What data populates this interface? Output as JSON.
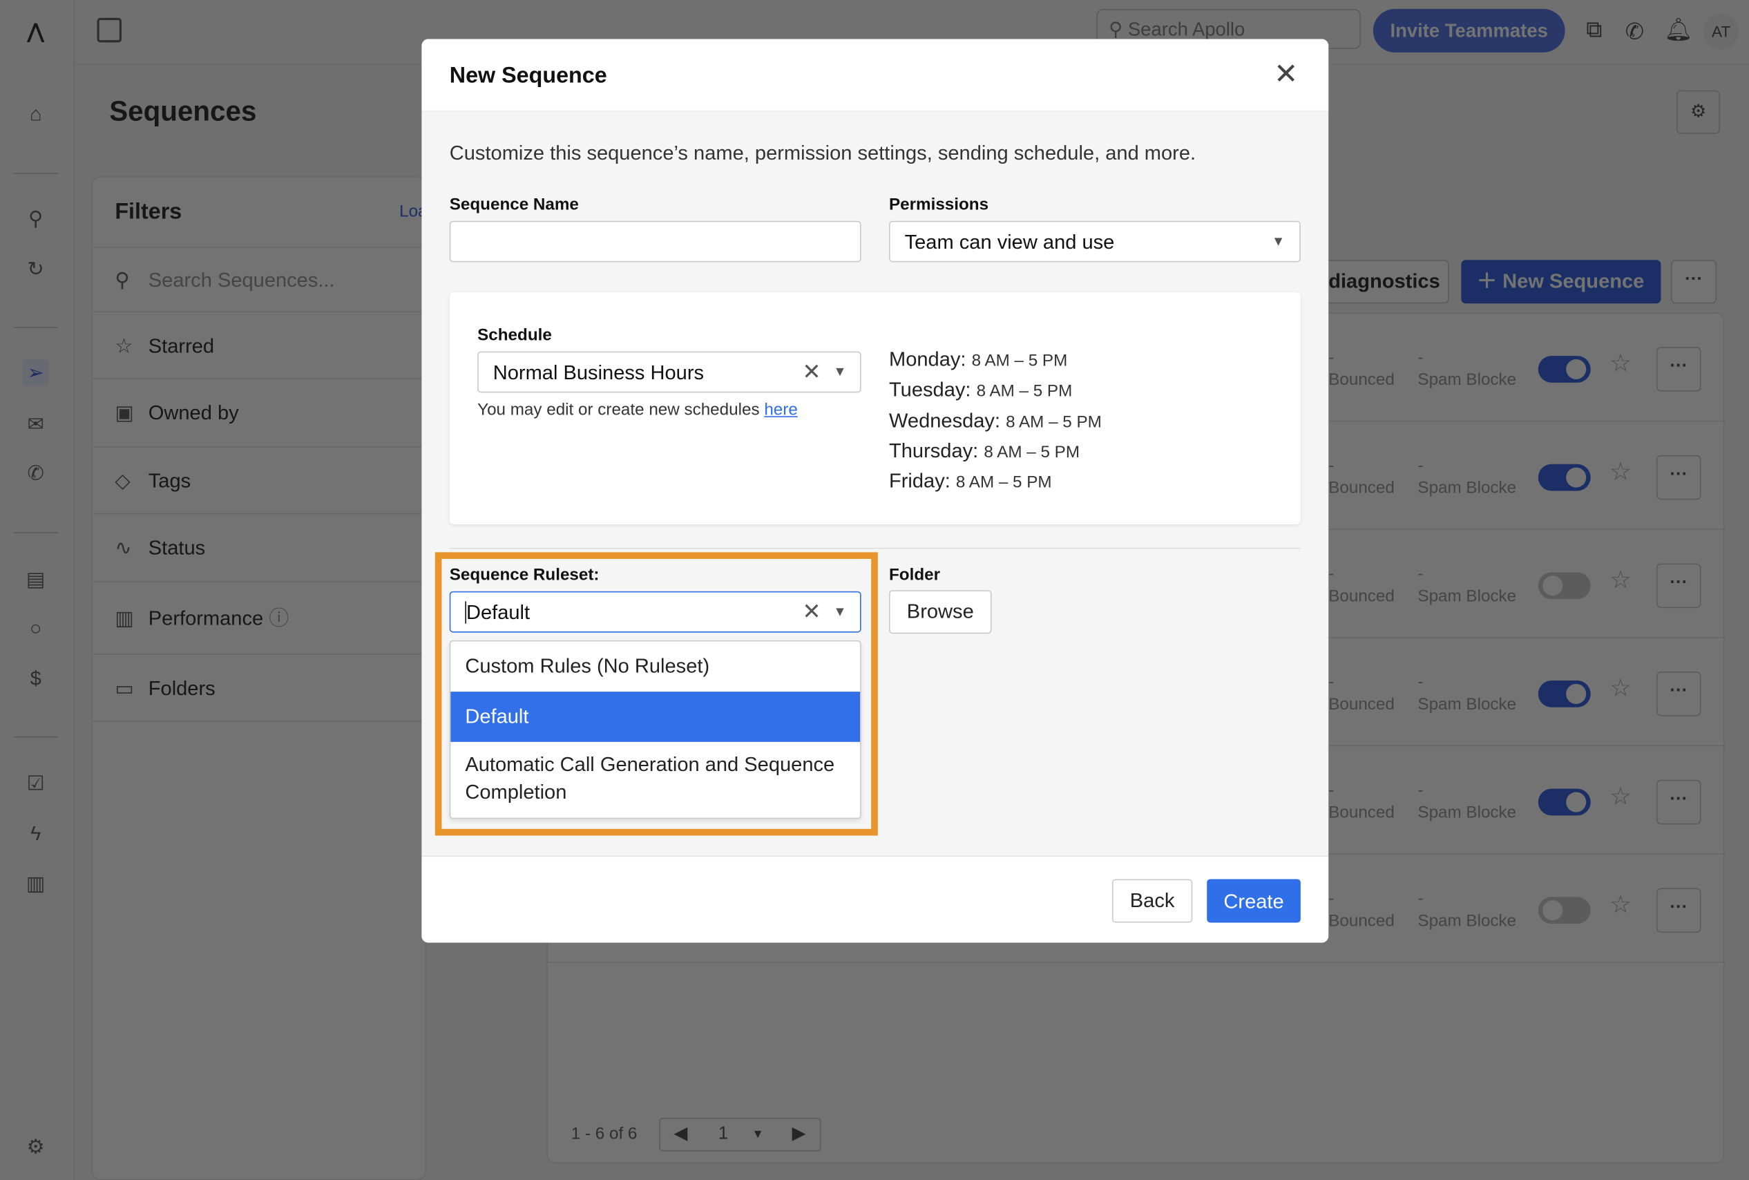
{
  "topbar": {
    "search_placeholder": "Search Apollo",
    "invite_label": "Invite Teammates",
    "avatar": "AT"
  },
  "page": {
    "title": "Sequences"
  },
  "filters": {
    "title": "Filters",
    "load_link": "Loa",
    "search_placeholder": "Search Sequences...",
    "items": [
      "Starred",
      "Owned by",
      "Tags",
      "Status",
      "Performance",
      "Folders"
    ]
  },
  "toolbar": {
    "diagnostics": "diagnostics",
    "new_sequence": "New Sequence"
  },
  "rows": [
    {
      "bounced": "Bounced",
      "spam": "Spam Blocke",
      "dash": "-",
      "enabled": true
    },
    {
      "bounced": "Bounced",
      "spam": "Spam Blocke",
      "dash": "-",
      "enabled": true
    },
    {
      "bounced": "Bounced",
      "spam": "Spam Blocke",
      "dash": "-",
      "enabled": false
    },
    {
      "bounced": "Bounced",
      "spam": "Spam Blocke",
      "dash": "-",
      "enabled": true
    },
    {
      "bounced": "Bounced",
      "spam": "Spam Blocke",
      "dash": "-",
      "enabled": true
    },
    {
      "bounced": "Bounced",
      "spam": "Spam Blocke",
      "dash": "-",
      "enabled": false
    }
  ],
  "pagination": {
    "range": "1 - 6 of 6",
    "page": "1"
  },
  "modal": {
    "title": "New Sequence",
    "description": "Customize this sequence’s name, permission settings, sending schedule, and more.",
    "name_label": "Sequence Name",
    "name_value": "",
    "permissions_label": "Permissions",
    "permissions_value": "Team can view and use",
    "schedule_label": "Schedule",
    "schedule_value": "Normal Business Hours",
    "schedule_hint": "You may edit or create new schedules ",
    "schedule_link": "here",
    "days": [
      {
        "day": "Monday:",
        "hours": "8 AM – 5 PM"
      },
      {
        "day": "Tuesday:",
        "hours": "8 AM – 5 PM"
      },
      {
        "day": "Wednesday:",
        "hours": "8 AM – 5 PM"
      },
      {
        "day": "Thursday:",
        "hours": "8 AM – 5 PM"
      },
      {
        "day": "Friday:",
        "hours": "8 AM – 5 PM"
      }
    ],
    "ruleset_label": "Sequence Ruleset:",
    "ruleset_value": "Default",
    "ruleset_options": [
      "Custom Rules (No Ruleset)",
      "Default",
      "Automatic Call Generation and Sequence Completion"
    ],
    "folder_label": "Folder",
    "browse": "Browse",
    "back": "Back",
    "create": "Create"
  },
  "colors": {
    "accent": "#2f6fe8",
    "highlight": "#e8952e"
  }
}
